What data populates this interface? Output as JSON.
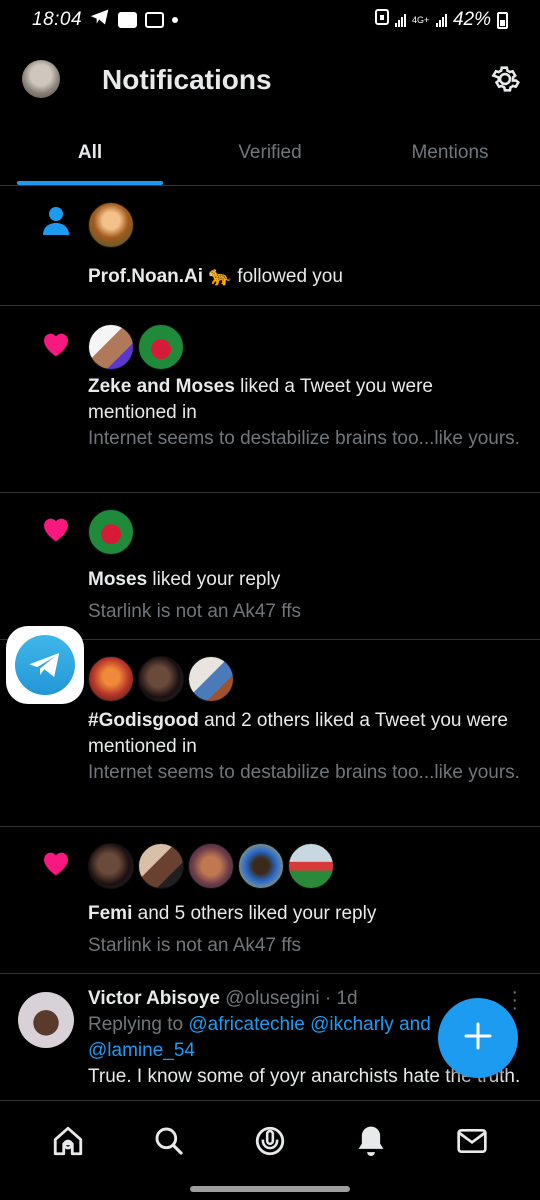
{
  "status_bar": {
    "time": "18:04",
    "network": "4G+",
    "battery": "42%"
  },
  "header": {
    "title": "Notifications"
  },
  "tabs": [
    {
      "label": "All",
      "active": true
    },
    {
      "label": "Verified",
      "active": false
    },
    {
      "label": "Mentions",
      "active": false
    }
  ],
  "notifications": [
    {
      "type": "follow",
      "actor": "Prof.Noan.Ai",
      "action": "followed you",
      "emoji": "🐆"
    },
    {
      "type": "like",
      "actor": "Zeke and Moses",
      "action": "liked a Tweet you were mentioned in",
      "snippet": "Internet seems to destabilize brains too...like yours."
    },
    {
      "type": "like",
      "actor": "Moses",
      "action": "liked your reply",
      "snippet": "Starlink is not an Ak47 ffs"
    },
    {
      "type": "like",
      "actor": "#Godisgood",
      "action": "and 2 others liked a Tweet you were mentioned in",
      "snippet": "Internet seems to destabilize brains too...like yours."
    },
    {
      "type": "like",
      "actor": "Femi",
      "action": "and 5 others liked your reply",
      "snippet": "Starlink is not an Ak47 ffs"
    }
  ],
  "tweet": {
    "name": "Victor Abisoye",
    "handle": "@olusegini",
    "time": "· 1d",
    "replying_prefix": "Replying to",
    "replying_1": "@africatechie",
    "replying_2": "@ikcharly",
    "replying_and": "and",
    "replying_3": "@lamine_54",
    "text": "True. I know some of yoyr anarchists hate the truth."
  },
  "colors": {
    "accent": "#1d9bf0",
    "like": "#f91880",
    "muted": "#71767b",
    "text": "#e7e9ea",
    "background": "#000000",
    "divider": "#2f3336"
  },
  "icons": {
    "follow": "person-icon",
    "like": "heart-icon",
    "settings": "gear-icon",
    "compose": "plus-icon",
    "nav": [
      "home-icon",
      "search-icon",
      "spaces-icon",
      "bell-icon",
      "mail-icon"
    ]
  }
}
